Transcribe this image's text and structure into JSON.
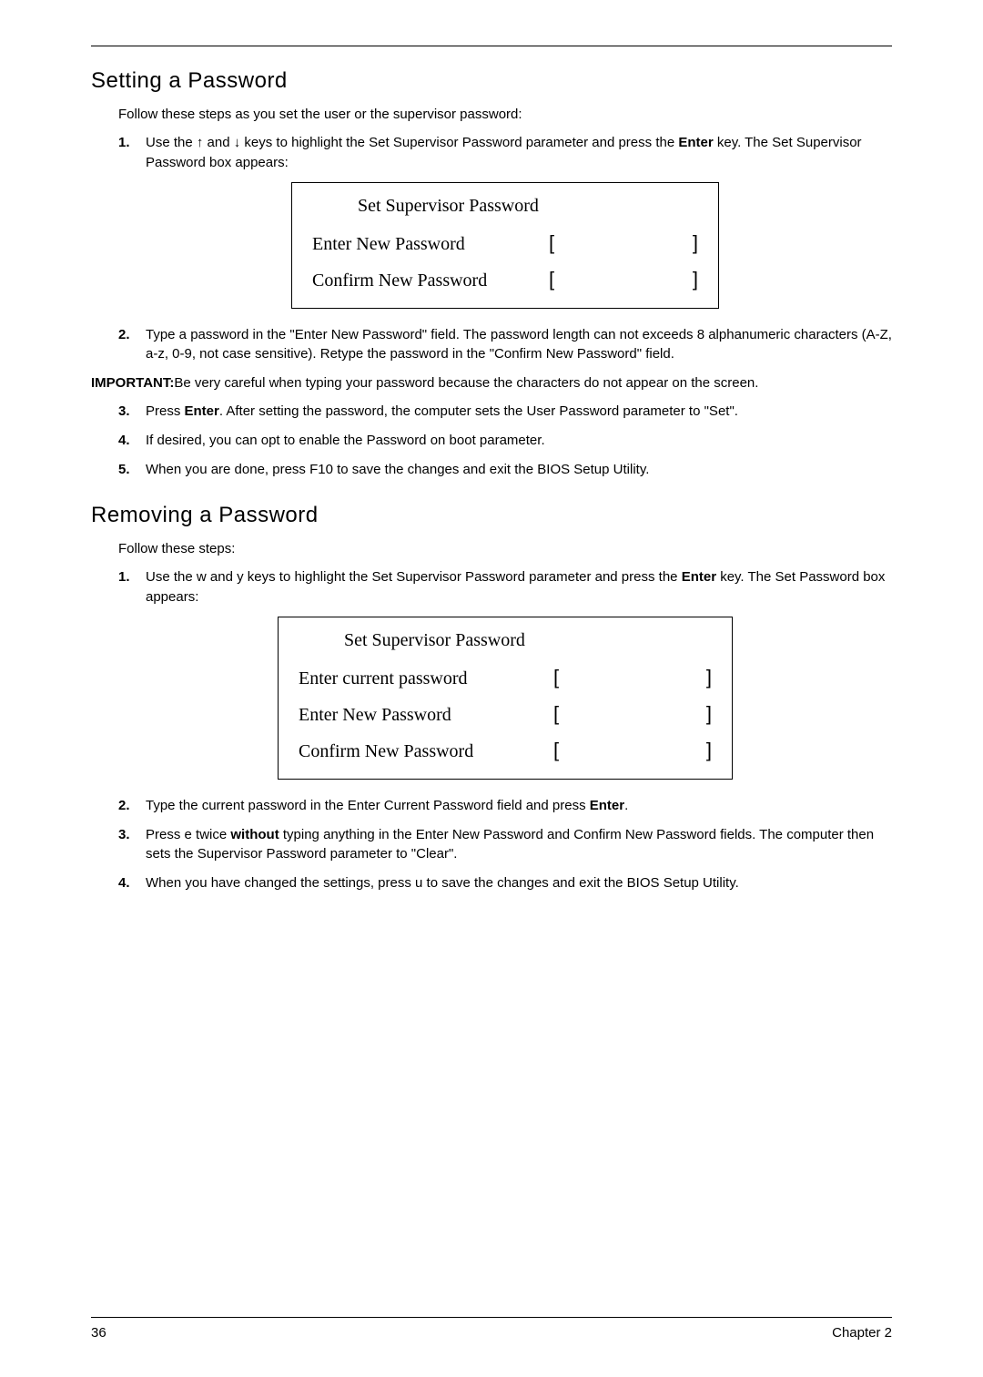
{
  "sections": {
    "setting": {
      "title": "Setting a Password",
      "intro": "Follow these steps as you set the user or the supervisor password:",
      "step1_pre": "Use the ",
      "up_arrow": "↑",
      "and_word": " and ",
      "down_arrow": "↓",
      "step1_mid": " keys to highlight the Set Supervisor Password parameter and press the ",
      "enter_word": "Enter",
      "step1_post": " key. The Set Supervisor Password box appears:",
      "bios": {
        "title": "Set Supervisor Password",
        "row1": "Enter New Password",
        "row2": "Confirm New Password"
      },
      "step2": "Type a password in the \"Enter New Password\" field. The password length can not exceeds 8 alphanumeric characters (A-Z, a-z, 0-9, not case sensitive). Retype the password in the \"Confirm New Password\" field.",
      "important_label": "IMPORTANT:",
      "important_text": "Be very careful when typing your password because the characters do not appear on the screen.",
      "step3_pre": "Press ",
      "step3_enter": "Enter",
      "step3_post": ". After setting the password, the computer sets the User Password parameter to \"Set\".",
      "step4": "If desired, you can opt to enable the Password on boot parameter.",
      "step5": "When you are done, press F10 to save the changes and exit the BIOS Setup Utility."
    },
    "removing": {
      "title": "Removing a Password",
      "intro": "Follow these steps:",
      "step1_pre": "Use the ",
      "w_key": "w",
      "and_word": " and ",
      "y_key": "y",
      "step1_mid": " keys to highlight the Set Supervisor Password parameter and press the ",
      "enter_word": "Enter",
      "step1_post": " key. The Set Password box appears:",
      "bios": {
        "title": "Set Supervisor Password",
        "row1": "Enter current password",
        "row2": "Enter New Password",
        "row3": "Confirm New Password"
      },
      "step2_pre": "Type the current password in the Enter Current Password field and press ",
      "step2_enter": "Enter",
      "step2_post": ".",
      "step3_pre": "Press ",
      "step3_ekey": "e",
      "step3_mid1": " twice ",
      "step3_without": "without",
      "step3_post": " typing anything in the Enter New Password and Confirm New Password fields. The computer then sets the Supervisor Password parameter to \"Clear\".",
      "step4_pre": "When you have changed the settings, press ",
      "step4_ukey": "u",
      "step4_post": " to save the changes and exit the BIOS Setup Utility."
    }
  },
  "nums": {
    "n1": "1.",
    "n2": "2.",
    "n3": "3.",
    "n4": "4.",
    "n5": "5."
  },
  "brackets": {
    "l": "[",
    "r": "]"
  },
  "footer": {
    "page": "36",
    "chapter": "Chapter 2"
  }
}
